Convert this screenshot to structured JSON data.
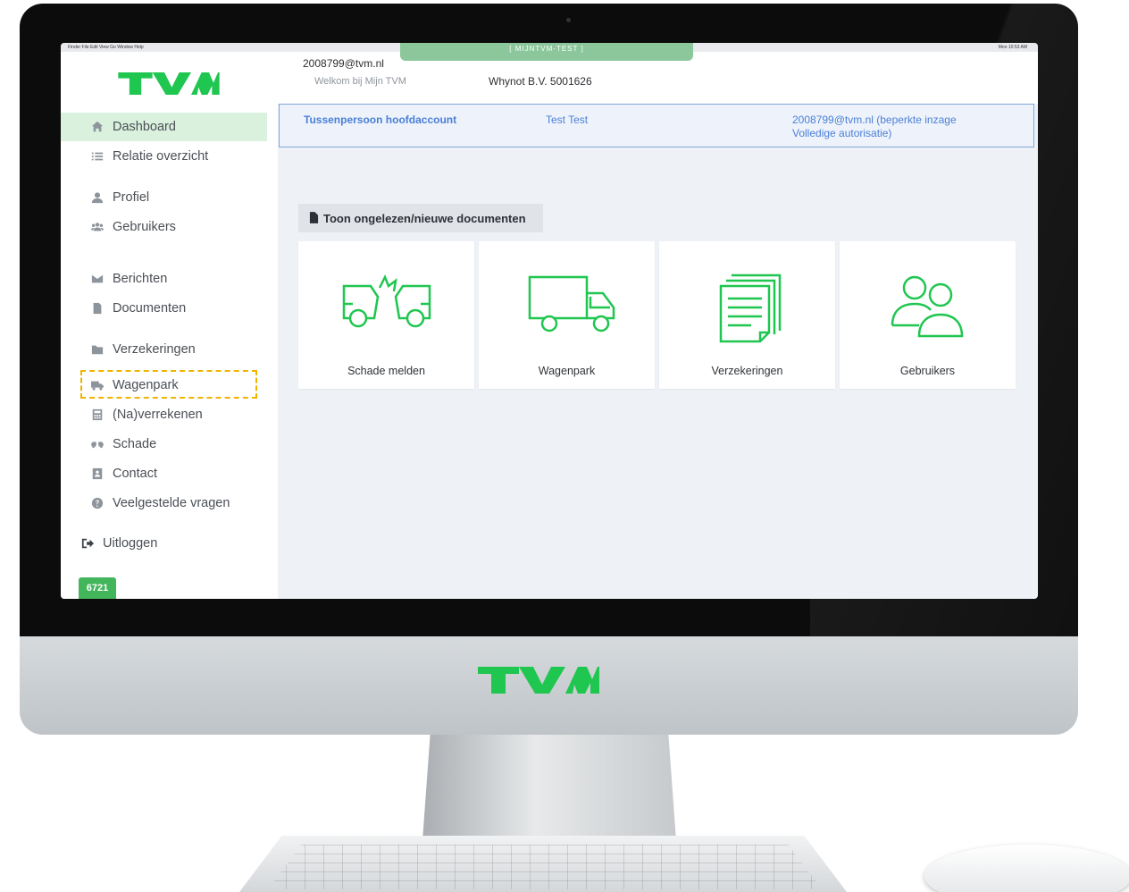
{
  "brand": {
    "logo_text": "TVM",
    "accent_color": "#1fc64f"
  },
  "mac_menu": {
    "items": "Finder  File  Edit  View  Go  Window  Help",
    "status": "Mon 10:53 AM"
  },
  "environment_label": "[ MIJNTVM-TEST ]",
  "header": {
    "email": "2008799@tvm.nl",
    "welcome": "Welkom bij Mijn TVM",
    "company": "Whynot B.V. 5001626"
  },
  "infobar": {
    "role": "Tussenpersoon hoofdaccount",
    "name": "Test Test",
    "auth_line1": "2008799@tvm.nl (beperkte inzage",
    "auth_line2": "Volledige autorisatie)"
  },
  "sidebar": {
    "items": [
      {
        "label": "Dashboard",
        "icon": "home-icon",
        "active": true
      },
      {
        "label": "Relatie overzicht",
        "icon": "list-icon"
      },
      {
        "label": "Profiel",
        "icon": "user-icon"
      },
      {
        "label": "Gebruikers",
        "icon": "users-icon"
      },
      {
        "label": "Berichten",
        "icon": "envelope-icon"
      },
      {
        "label": "Documenten",
        "icon": "file-icon"
      },
      {
        "label": "Verzekeringen",
        "icon": "folder-icon"
      },
      {
        "label": "Wagenpark",
        "icon": "truck-icon",
        "highlighted": true
      },
      {
        "label": "(Na)verrekenen",
        "icon": "calculator-icon"
      },
      {
        "label": "Schade",
        "icon": "car-crash-icon"
      },
      {
        "label": "Contact",
        "icon": "contact-card-icon"
      },
      {
        "label": "Veelgestelde vragen",
        "icon": "question-circle-icon"
      }
    ],
    "logout_label": "Uitloggen",
    "version": "6721"
  },
  "main": {
    "toggle_label": "Toon ongelezen/nieuwe documenten",
    "tiles": [
      {
        "label": "Schade melden",
        "icon": "car-crash-icon"
      },
      {
        "label": "Wagenpark",
        "icon": "truck-icon"
      },
      {
        "label": "Verzekeringen",
        "icon": "documents-icon"
      },
      {
        "label": "Gebruikers",
        "icon": "users-icon"
      }
    ]
  },
  "monitor_logo": "TVM"
}
